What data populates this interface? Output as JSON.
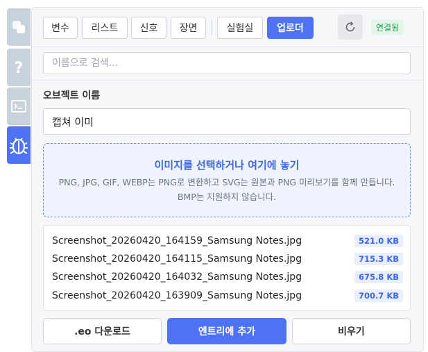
{
  "rail": {
    "items": [
      {
        "icon": "blocks-icon"
      },
      {
        "icon": "help-icon"
      },
      {
        "icon": "terminal-icon"
      },
      {
        "icon": "bug-icon"
      }
    ]
  },
  "tabs": [
    {
      "label": "변수"
    },
    {
      "label": "리스트"
    },
    {
      "label": "신호"
    },
    {
      "label": "장면"
    },
    {
      "label": "실험실"
    },
    {
      "label": "업로더"
    }
  ],
  "header": {
    "refresh_icon": "refresh-icon",
    "status": "연결됨"
  },
  "search": {
    "placeholder": "이름으로 검색...",
    "value": ""
  },
  "object_name": {
    "label": "오브젝트 이름",
    "value": "캡쳐 이미"
  },
  "dropzone": {
    "title": "이미지를 선택하거나 여기에 놓기",
    "description": "PNG, JPG, GIF, WEBP는 PNG로 변환하고 SVG는 원본과 PNG 미리보기를 함께 만듭니다. BMP는 지원하지 않습니다."
  },
  "files": [
    {
      "name": "Screenshot_20260420_164159_Samsung Notes.jpg",
      "size": "521.0 KB"
    },
    {
      "name": "Screenshot_20260420_164115_Samsung Notes.jpg",
      "size": "715.3 KB"
    },
    {
      "name": "Screenshot_20260420_164032_Samsung Notes.jpg",
      "size": "675.8 KB"
    },
    {
      "name": "Screenshot_20260420_163909_Samsung Notes.jpg",
      "size": "700.7 KB"
    }
  ],
  "actions": {
    "download": ".eo 다운로드",
    "add": "엔트리에 추가",
    "clear": "비우기"
  },
  "colors": {
    "accent": "#4d72f5",
    "status_bg": "#e3f6e9",
    "status_text": "#2b9a55"
  }
}
